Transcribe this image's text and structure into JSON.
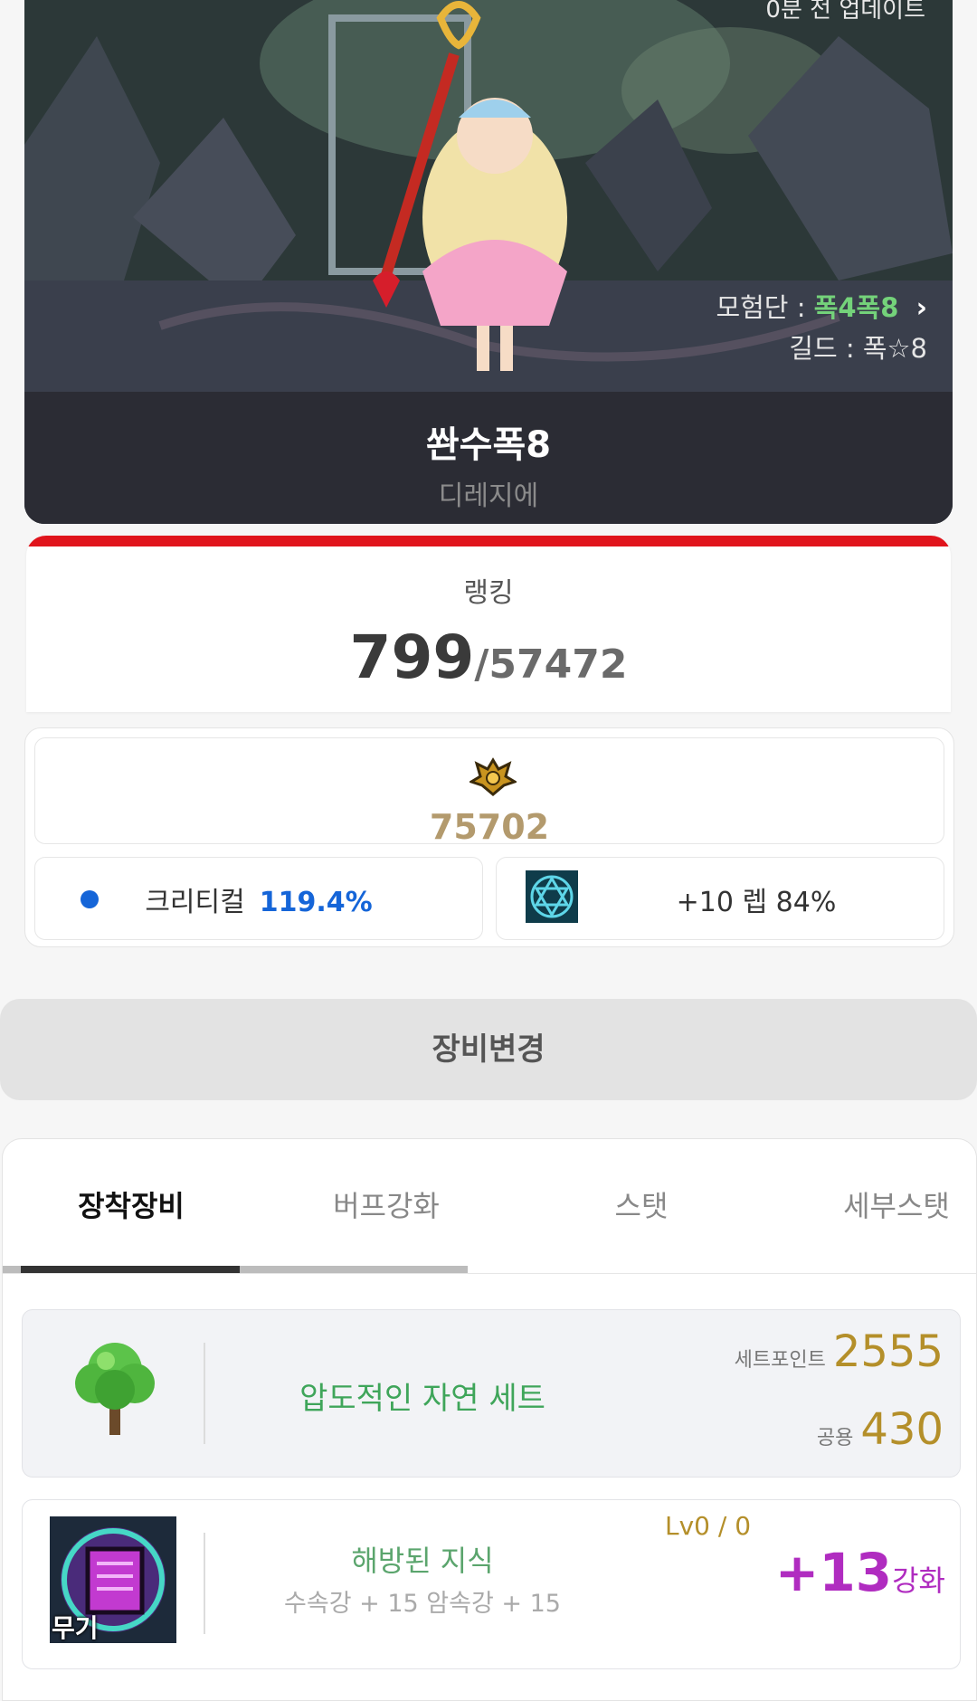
{
  "banner": {
    "update_text": "0분 전 업데이트",
    "adventure_label": "모험단 :",
    "adventure_name": "폭4폭8",
    "guild_label": "길드 :",
    "guild_name": "폭☆8",
    "character_name": "쏸수폭8",
    "server_name": "디레지에"
  },
  "ranking": {
    "label": "랭킹",
    "rank": "799",
    "total": "/57472"
  },
  "stats": {
    "fame_icon": "fame-emblem-icon",
    "fame_value": "75702",
    "crit_label": "크리티컬",
    "crit_value": "119.4%",
    "level_text": "+10 렙 84%"
  },
  "change_button_label": "장비변경",
  "tabs": [
    {
      "label": "장착장비",
      "active": true
    },
    {
      "label": "버프강화",
      "active": false
    },
    {
      "label": "스탯",
      "active": false
    },
    {
      "label": "세부스탯",
      "active": false
    }
  ],
  "set_item": {
    "icon": "tree-icon",
    "name": "압도적인 자연 세트",
    "point_label": "세트포인트",
    "point_value": "2555",
    "common_label": "공용",
    "common_value": "430"
  },
  "weapon": {
    "icon": "weapon-book-icon",
    "slot_label": "무기",
    "name": "해방된 지식",
    "options": "수속강 + 15 암속강 + 15",
    "level": "Lv0 / 0",
    "enhance_value": "+13",
    "enhance_label": "강화"
  },
  "colors": {
    "accent_red": "#e0141c",
    "crit_blue": "#1565d8",
    "set_green": "#3fa55a",
    "gold": "#b48f2a",
    "enhance_purple": "#b02cc0"
  }
}
